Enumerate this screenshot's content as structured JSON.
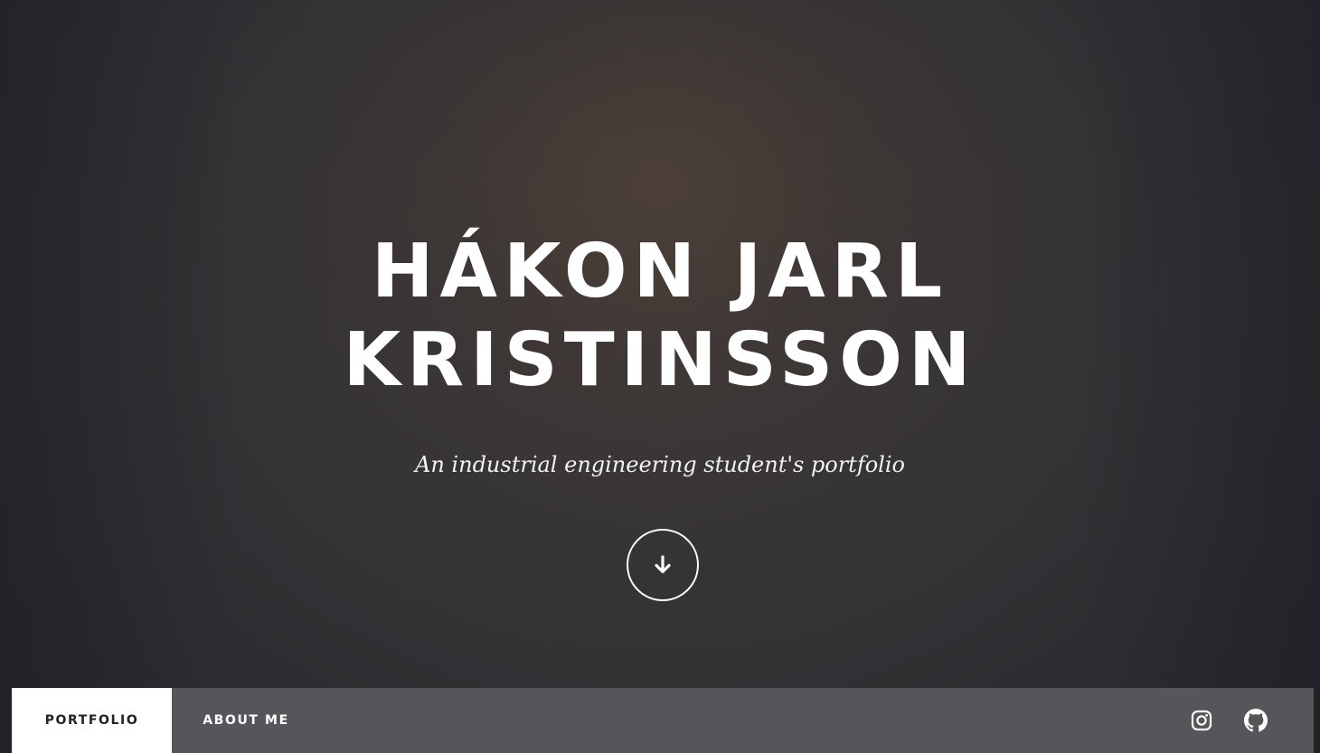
{
  "hero": {
    "name_line_1": "HÁKON JARL",
    "name_line_2": "KRISTINSSON",
    "subtitle": "An industrial engineering student's portfolio",
    "scroll_icon": "arrow-down-icon"
  },
  "nav": {
    "items": [
      {
        "label": "PORTFOLIO",
        "active": true
      },
      {
        "label": "ABOUT ME",
        "active": false
      }
    ],
    "social": [
      {
        "icon": "instagram-icon"
      },
      {
        "icon": "github-icon"
      }
    ]
  },
  "colors": {
    "navbar_bg": "#55555a",
    "active_tab_bg": "#ffffff",
    "text": "#ffffff"
  }
}
